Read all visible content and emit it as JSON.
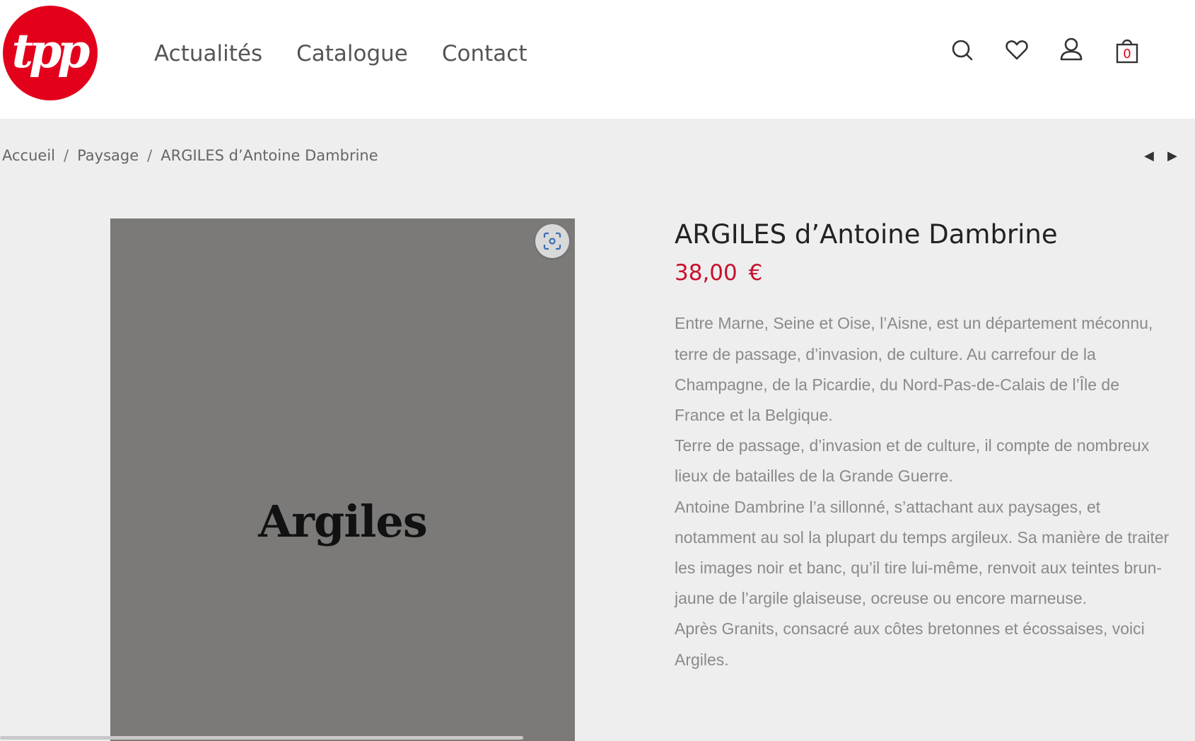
{
  "header": {
    "logo_text": "tpp",
    "nav": [
      "Actualités",
      "Catalogue",
      "Contact"
    ],
    "cart_count": "0",
    "icons": [
      "search-icon",
      "heart-icon",
      "user-icon",
      "cart-icon"
    ]
  },
  "breadcrumb": {
    "home": "Accueil",
    "category": "Paysage",
    "current": "ARGILES d’Antoine Dambrine",
    "separator": "/"
  },
  "pager": {
    "prev": "◀",
    "next": "▶"
  },
  "product": {
    "cover_title": "Argiles",
    "title": "ARGILES d’Antoine Dambrine",
    "price": "38,00 €",
    "description": [
      "Entre Marne, Seine et Oise, l’Aisne, est un département méconnu, terre de passage, d’invasion, de culture. Au carrefour de la Champagne, de la Picardie, du Nord-Pas-de-Calais de l’Île de France et la Belgique.",
      "Terre de passage, d’invasion et de culture, il compte de nombreux lieux de batailles de la Grande Guerre.",
      "Antoine Dambrine l’a sillonné, s’attachant aux paysages, et notamment au sol la plupart du temps argileux. Sa manière de traiter les images noir et banc, qu’il tire lui-même, renvoit aux teintes brun-jaune de l’argile glaiseuse, ocreuse ou encore marneuse.",
      "Après Granits, consacré aux côtes bretonnes et écossaises, voici Argiles."
    ]
  },
  "colors": {
    "brand_red": "#e3001b",
    "price_red": "#c8102e",
    "page_bg": "#eeeeee",
    "cover_bg": "#7b7a79"
  }
}
